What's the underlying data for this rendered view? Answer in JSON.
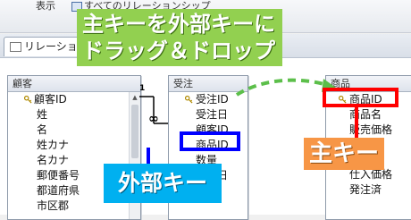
{
  "ribbon": {
    "view_label": "表示",
    "all_relationships_label": "すべてのリレーションシップ"
  },
  "tab": {
    "label": "リレーションシップ"
  },
  "tables": {
    "customers": {
      "title": "顧客",
      "fields": [
        "顧客ID",
        "姓",
        "名",
        "姓カナ",
        "名カナ",
        "郵便番号",
        "都道府県",
        "市区郡"
      ]
    },
    "orders": {
      "title": "受注",
      "fields": [
        "受注ID",
        "受注日",
        "顧客ID",
        "商品ID",
        "数量",
        "発送日"
      ]
    },
    "products": {
      "title": "商品",
      "fields": [
        "商品ID",
        "商品名",
        "販売価格",
        "",
        "仕入価格",
        "発注済"
      ]
    }
  },
  "relationship": {
    "one_label": "1",
    "many_label": "∞"
  },
  "callouts": {
    "drag_drop": "主キーを外部キーにドラッグ＆ドロップ",
    "primary_key": "主キー",
    "foreign_key": "外部キー"
  },
  "colors": {
    "primary_key_box": "#ff0000",
    "foreign_key_box": "#0000ff",
    "drag_drop_callout": "#92d050",
    "primary_key_callout": "#f79646",
    "foreign_key_callout": "#00b0f0",
    "drag_arrow": "#5cbf4a"
  },
  "icons": [
    "key-icon",
    "table-icon",
    "relationships-icon"
  ]
}
